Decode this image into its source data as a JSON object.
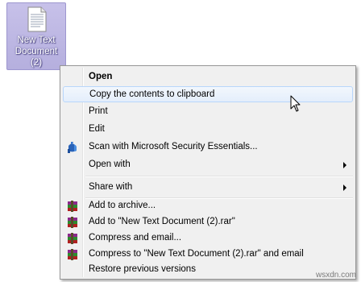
{
  "desktop_icon": {
    "label_lines": [
      "New Text",
      "Document",
      "(2)"
    ],
    "icon": "text-file-icon"
  },
  "context_menu": {
    "items": [
      {
        "label": "Open",
        "bold": true
      },
      {
        "label": "Copy the contents to clipboard",
        "highlighted": true
      },
      {
        "label": "Print"
      },
      {
        "label": "Edit"
      },
      {
        "label": "Scan with Microsoft Security Essentials...",
        "icon": "security-essentials-icon"
      },
      {
        "label": "Open with",
        "submenu": true
      },
      {
        "label": "Share with",
        "submenu": true
      },
      {
        "label": "Add to archive...",
        "icon": "winrar-icon"
      },
      {
        "label": "Add to \"New Text Document (2).rar\"",
        "icon": "winrar-icon"
      },
      {
        "label": "Compress and email...",
        "icon": "winrar-icon"
      },
      {
        "label": "Compress to \"New Text Document (2).rar\" and email",
        "icon": "winrar-icon"
      },
      {
        "label": "Restore previous versions"
      }
    ]
  },
  "watermark": "wsxdn.com",
  "colors": {
    "selection_fill": "#c7c1e9",
    "menu_background": "#f0f0f0",
    "highlight_border": "#b8d6fb"
  }
}
